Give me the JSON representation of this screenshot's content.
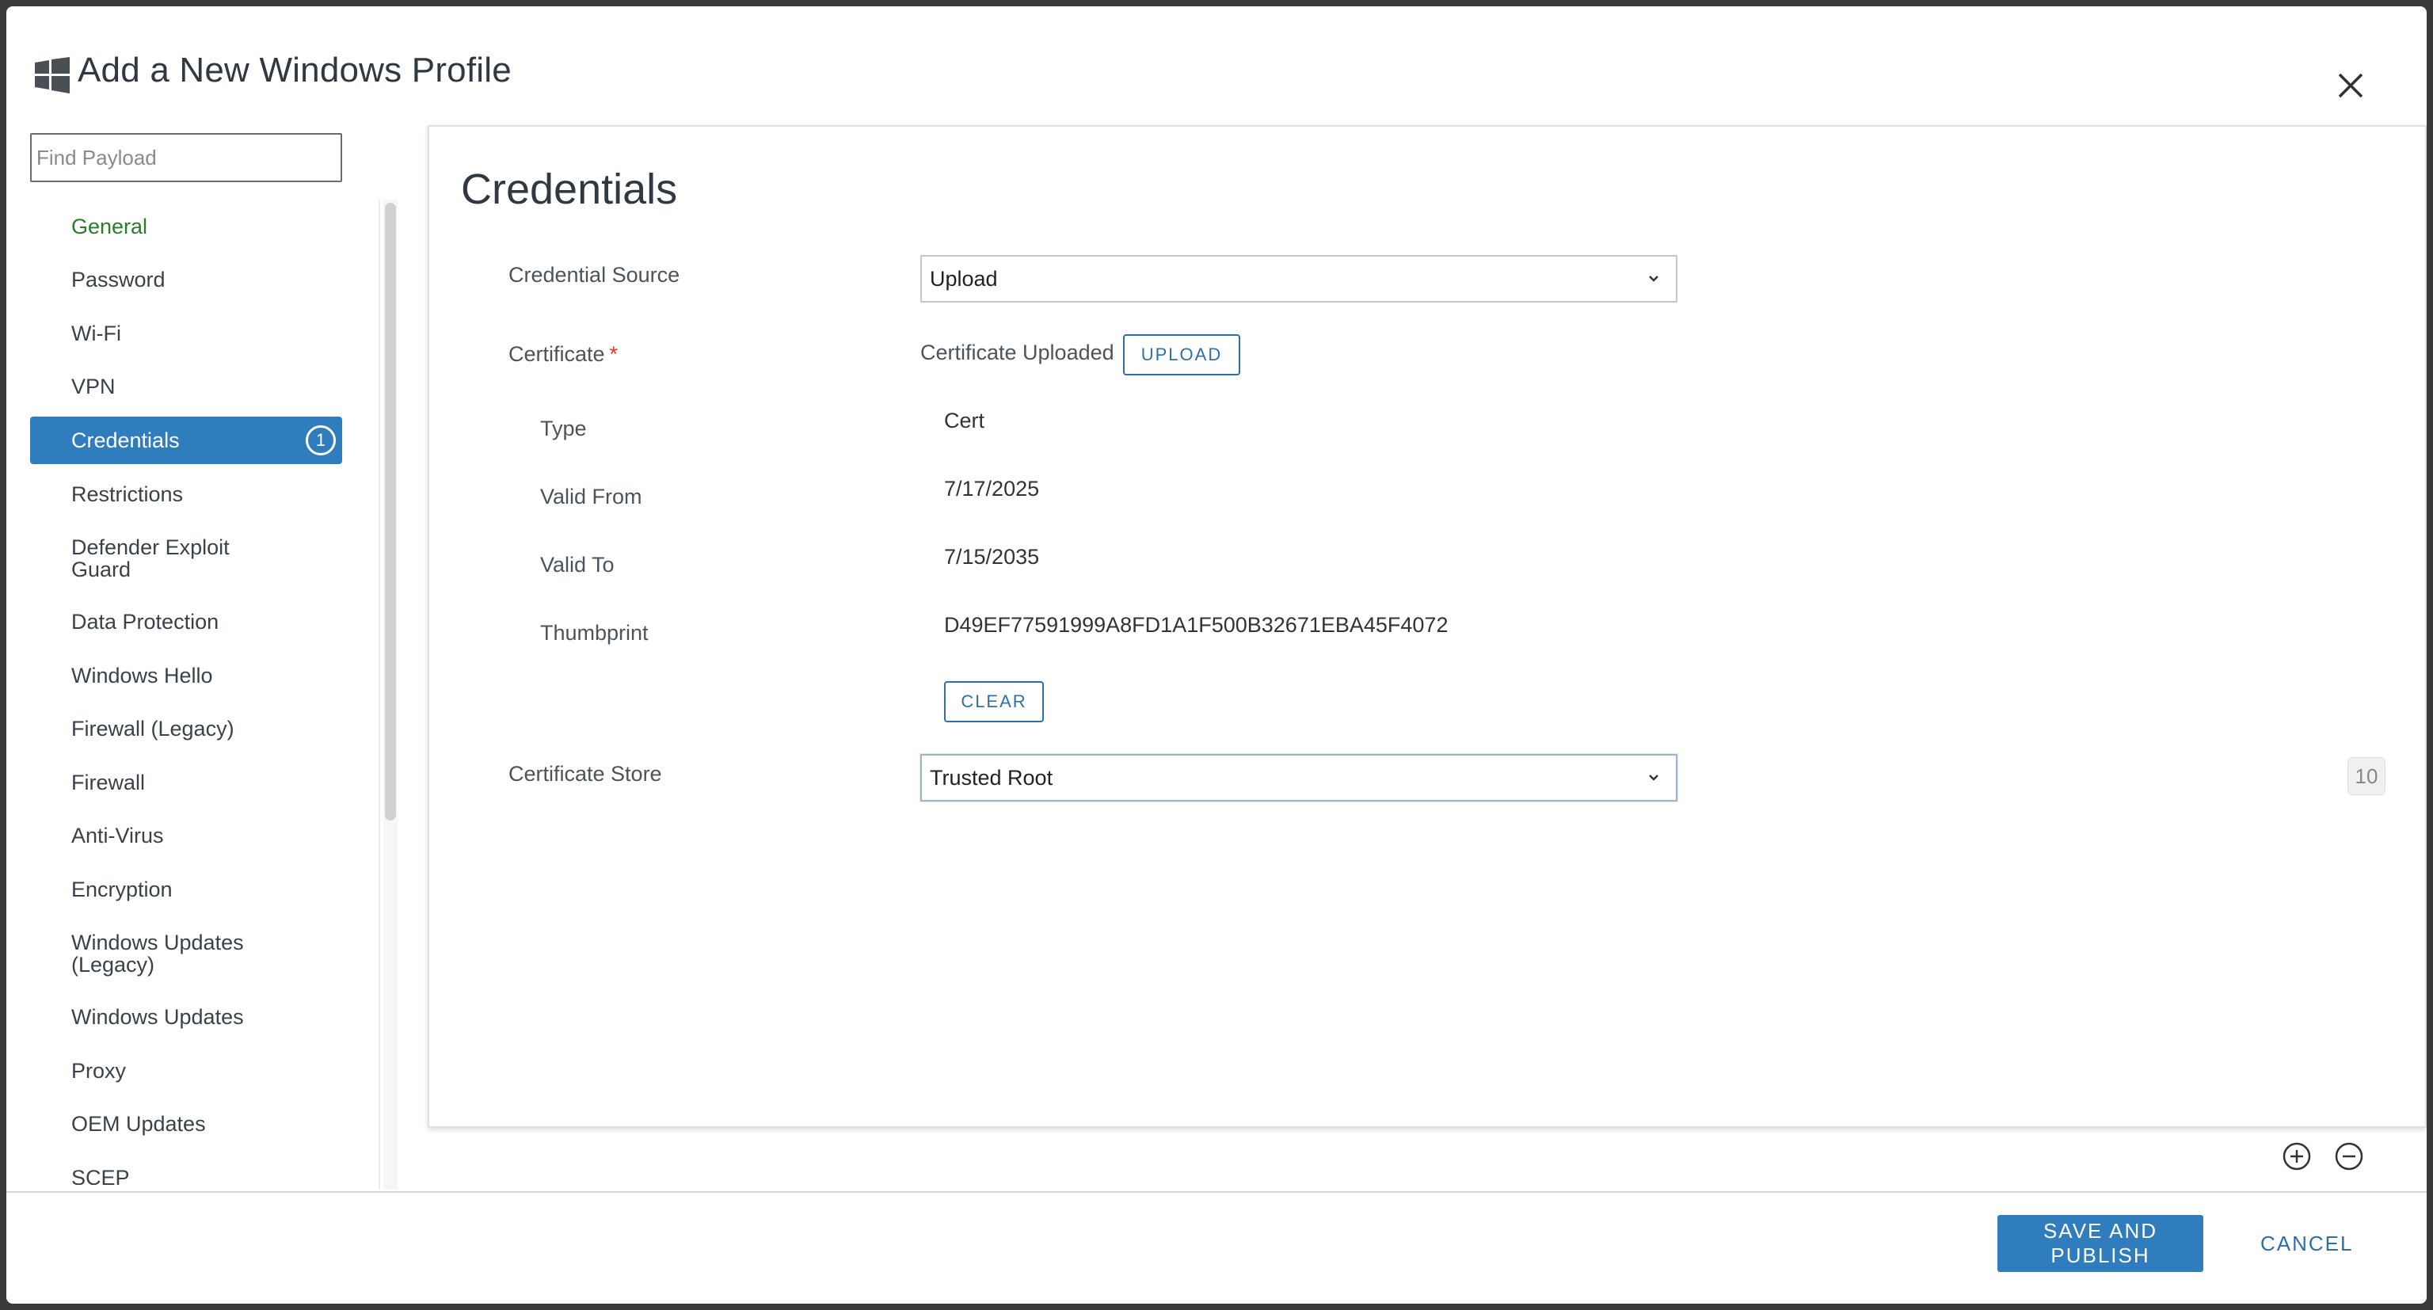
{
  "modal": {
    "title": "Add a New Windows Profile",
    "logo_icon": "windows-logo-icon",
    "close_icon": "close-icon"
  },
  "sidebar": {
    "search_placeholder": "Find Payload",
    "items": [
      {
        "label": "General"
      },
      {
        "label": "Password"
      },
      {
        "label": "Wi-Fi"
      },
      {
        "label": "VPN"
      },
      {
        "label": "Credentials",
        "badge": "1",
        "active": true
      },
      {
        "label": "Restrictions"
      },
      {
        "label": "Defender Exploit Guard"
      },
      {
        "label": "Data Protection"
      },
      {
        "label": "Windows Hello"
      },
      {
        "label": "Firewall (Legacy)"
      },
      {
        "label": "Firewall"
      },
      {
        "label": "Anti-Virus"
      },
      {
        "label": "Encryption"
      },
      {
        "label": "Windows Updates (Legacy)"
      },
      {
        "label": "Windows Updates"
      },
      {
        "label": "Proxy"
      },
      {
        "label": "OEM Updates"
      },
      {
        "label": "SCEP"
      }
    ]
  },
  "panel": {
    "title": "Credentials",
    "credential_source": {
      "label": "Credential Source",
      "value": "Upload"
    },
    "certificate": {
      "label": "Certificate",
      "required_mark": "*",
      "status": "Certificate Uploaded",
      "upload_label": "UPLOAD",
      "details": {
        "type_label": "Type",
        "type_value": "Cert",
        "valid_from_label": "Valid From",
        "valid_from_value": "7/17/2025",
        "valid_to_label": "Valid To",
        "valid_to_value": "7/15/2035",
        "thumbprint_label": "Thumbprint",
        "thumbprint_value": "D49EF77591999A8FD1A1F500B32671EBA45F4072"
      },
      "clear_label": "CLEAR"
    },
    "certificate_store": {
      "label": "Certificate Store",
      "value": "Trusted Root"
    },
    "counter": "10"
  },
  "payload_controls": {
    "add_icon": "plus-circle-icon",
    "remove_icon": "minus-circle-icon"
  },
  "footer": {
    "save_label": "SAVE AND PUBLISH",
    "cancel_label": "CANCEL"
  },
  "colors": {
    "primary": "#2f7dbd",
    "active_nav": "#2f7dbd",
    "general_nav": "#2c7a2c",
    "required": "#d9382f"
  }
}
